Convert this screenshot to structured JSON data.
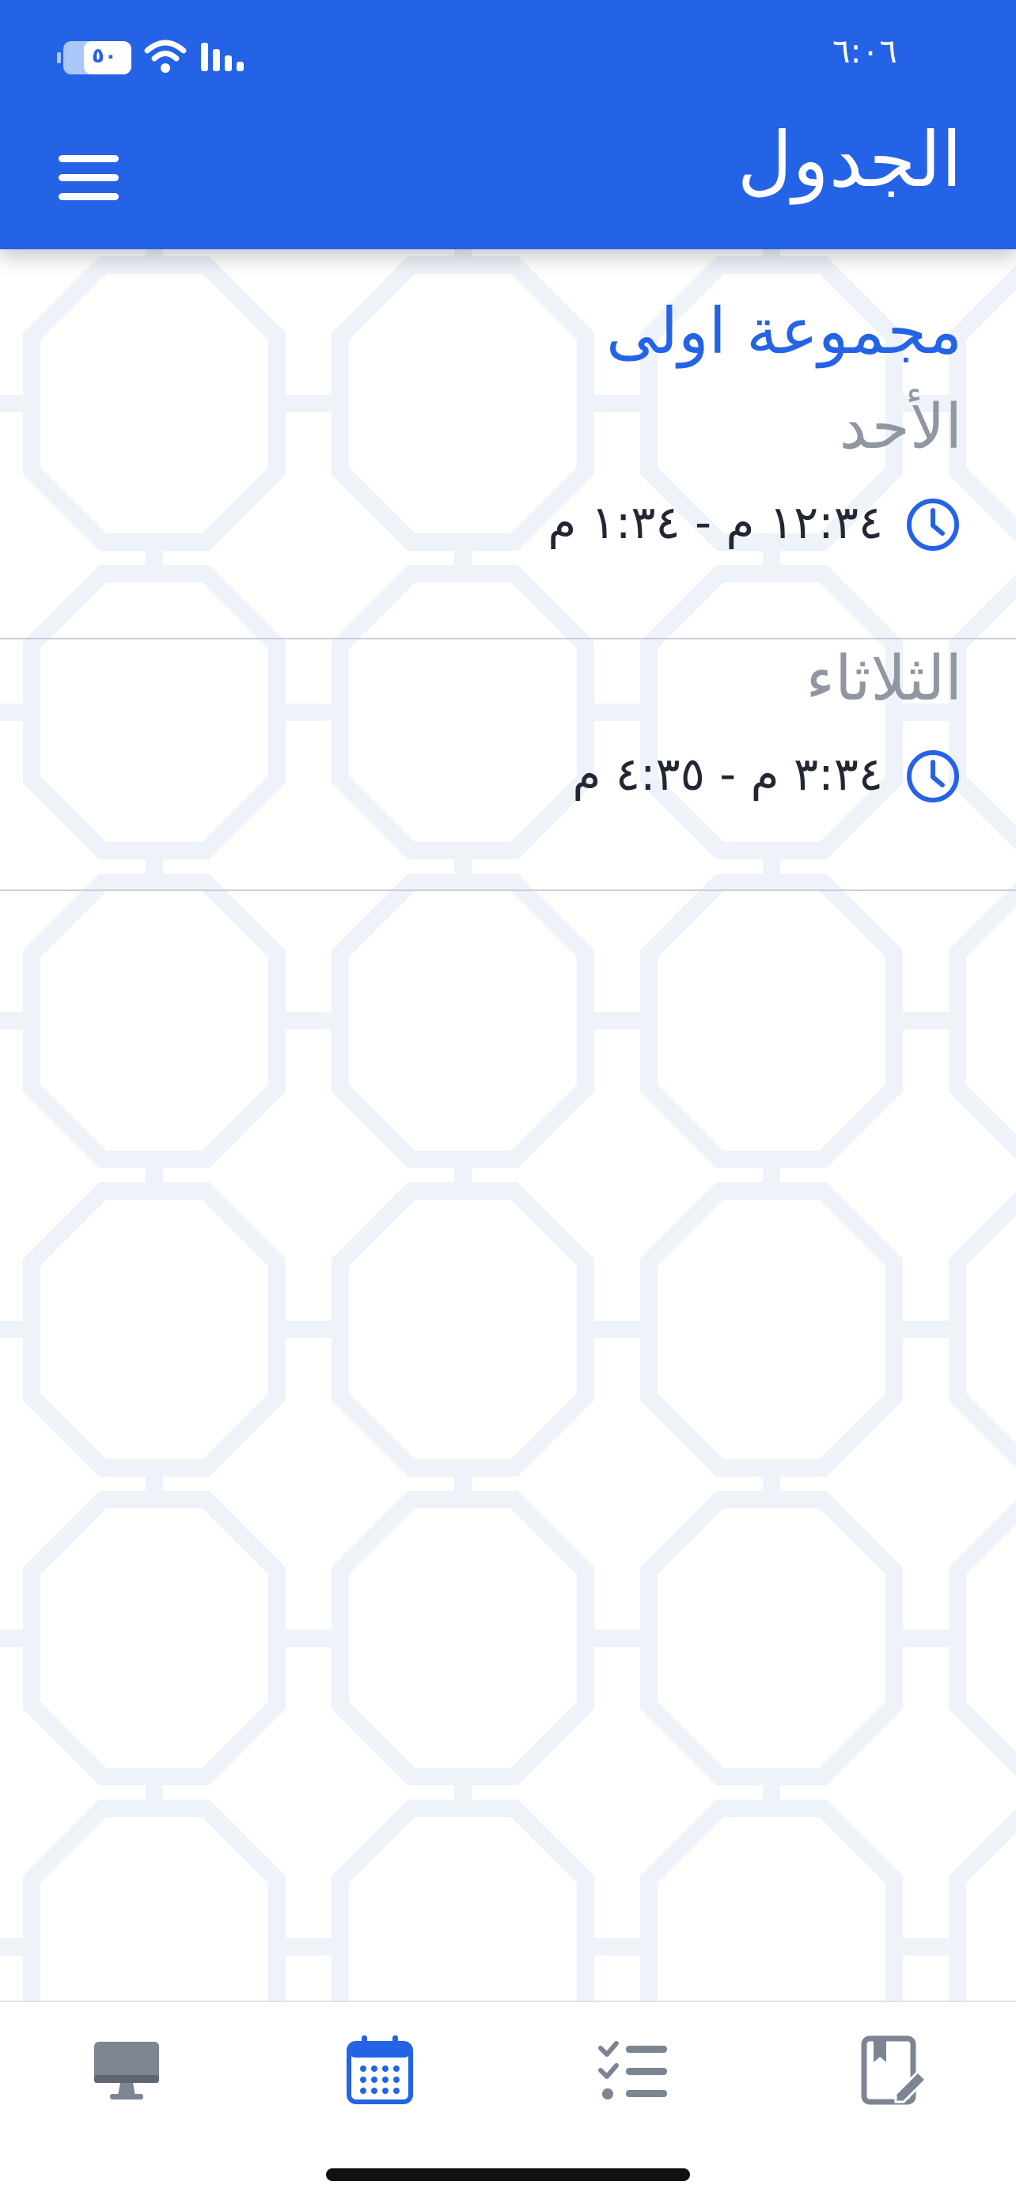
{
  "status_bar": {
    "time": "٦:٠٦",
    "battery_level": "٥٠"
  },
  "header": {
    "title": "الجدول"
  },
  "group": {
    "title": "مجموعة اولى"
  },
  "schedule": [
    {
      "day": "الأحد",
      "time_range": "١٢:٣٤ م - ١:٣٤ م"
    },
    {
      "day": "الثلاثاء",
      "time_range": "٣:٣٤ م - ٤:٣٥ م"
    }
  ],
  "bottom_nav": {
    "items": [
      {
        "icon": "desktop-icon",
        "active": false
      },
      {
        "icon": "calendar-icon",
        "active": true
      },
      {
        "icon": "checklist-icon",
        "active": false
      },
      {
        "icon": "notebook-edit-icon",
        "active": false
      }
    ]
  },
  "colors": {
    "primary": "#2563e6",
    "day_label": "#9097a1",
    "text": "#222731",
    "nav_inactive": "#7d8593",
    "pattern": "#f2f5fb"
  }
}
